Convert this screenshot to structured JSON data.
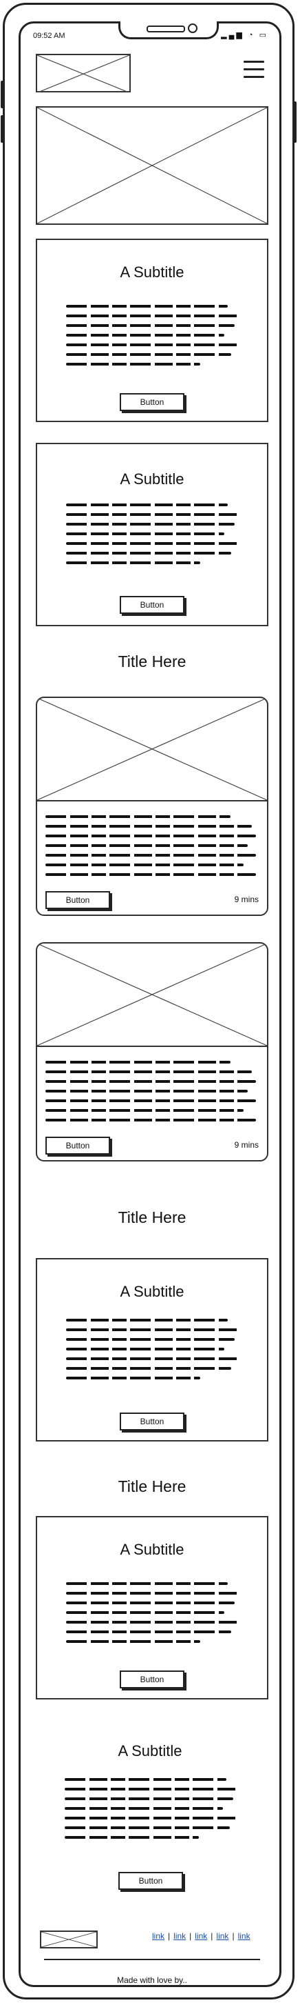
{
  "status": {
    "time": "09:52 AM",
    "icons": "▂▄▆ ◔ ▭"
  },
  "cards": [
    {
      "subtitle": "A Subtitle",
      "button": "Button"
    },
    {
      "subtitle": "A Subtitle",
      "button": "Button"
    }
  ],
  "section_1": {
    "title": "Title Here"
  },
  "feature_cards": [
    {
      "button": "Button",
      "duration": "9 mins"
    },
    {
      "button": "Button",
      "duration": "9 mins"
    }
  ],
  "section_2": {
    "title": "Title Here",
    "subtitle": "A Subtitle",
    "button": "Button"
  },
  "section_3": {
    "title": "Title Here",
    "subtitle": "A Subtitle",
    "button": "Button"
  },
  "section_4": {
    "subtitle": "A Subtitle",
    "button": "Button"
  },
  "footer": {
    "links": [
      "link",
      "link",
      "link",
      "link",
      "link"
    ],
    "tagline": "Made with love by.."
  }
}
